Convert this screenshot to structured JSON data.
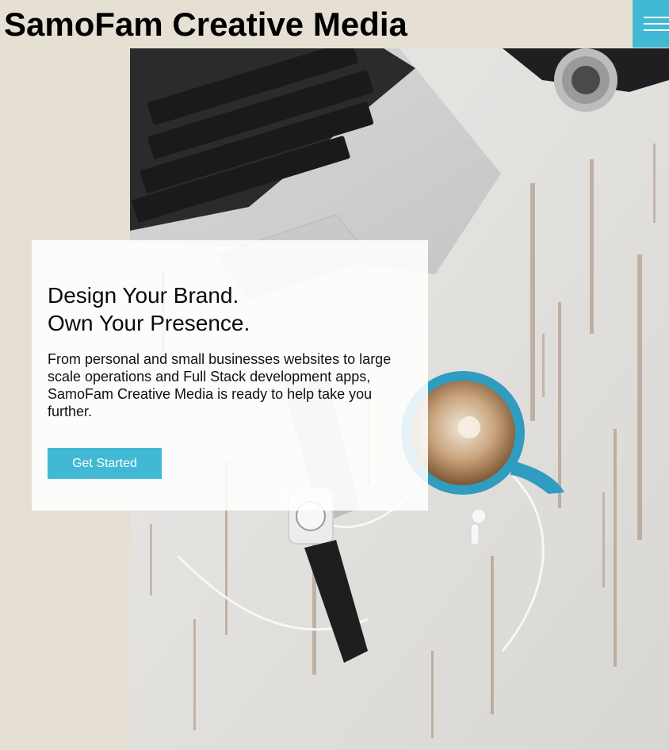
{
  "header": {
    "site_title": "SamoFam Creative Media",
    "menu_icon": "hamburger-menu-icon"
  },
  "hero": {
    "heading_line_1": "Design Your Brand.",
    "heading_line_2": "Own Your Presence.",
    "description": "From personal and small businesses websites to large scale operations and Full Stack development apps, SamoFam Creative Media is ready to help take you further.",
    "cta_label": "Get Started"
  },
  "colors": {
    "page_background": "#e6e0d4",
    "accent": "#41b9d4",
    "text": "#000000"
  }
}
